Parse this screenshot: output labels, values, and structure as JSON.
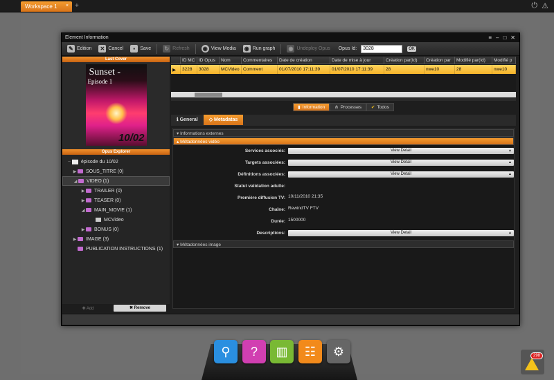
{
  "workspace_tab": {
    "label": "Workspace 1",
    "close": "×"
  },
  "add_tab": "+",
  "top_icons": {
    "power": "⏻",
    "alert": "⚠"
  },
  "window": {
    "title": "Element Information",
    "controls": [
      "≡",
      "–",
      "□",
      "✕"
    ]
  },
  "toolbar": {
    "edition": "Edition",
    "cancel": "Cancel",
    "save": "Save",
    "refresh": "Refresh",
    "view_media": "View Media",
    "run_graph": "Run graph",
    "undeploy": "Undeploy Opus",
    "opus_id_label": "Opus Id:",
    "opus_id_value": "3028",
    "ok": "OK"
  },
  "last_cover": {
    "header": "Last Cover",
    "title_line1": "Sunset -",
    "title_line2": "Episode 1",
    "number": "10/02"
  },
  "opus_explorer": {
    "header": "Opus Explorer",
    "nodes": [
      {
        "label": "épisode du 10/02",
        "toggle": "–"
      },
      {
        "label": "SOUS_TITRE (0)",
        "toggle": "▶"
      },
      {
        "label": "VIDEO (1)",
        "toggle": "◢"
      },
      {
        "label": "TRAILER (0)",
        "toggle": "▶"
      },
      {
        "label": "TEASER (0)",
        "toggle": "▶"
      },
      {
        "label": "MAIN_MOVIE (1)",
        "toggle": "◢"
      },
      {
        "label": "MCVideo",
        "toggle": ""
      },
      {
        "label": "BONUS (0)",
        "toggle": "▶"
      },
      {
        "label": "IMAGE (3)",
        "toggle": "▶"
      },
      {
        "label": "PUBLICATION INSTRUCTIONS (1)",
        "toggle": ""
      }
    ],
    "add_label": "Add",
    "remove_label": "Remove"
  },
  "grid": {
    "columns": [
      "",
      "ID MC",
      "ID Opus",
      "Nom",
      "Commentaires",
      "Date de création",
      "Date de mise à jour",
      "Création par(Id)",
      "Création par",
      "Modifié par(Id)",
      "Modifié p"
    ],
    "row": [
      "▶",
      "3228",
      "3028",
      "MCVideo",
      "Comment",
      "01/07/2010 17:11:39",
      "01/07/2010 17:11:39",
      "28",
      "nwe10",
      "28",
      "nwe10"
    ]
  },
  "view_tabs": {
    "information": "Information",
    "processes": "Processes",
    "todos": "Todos"
  },
  "detail_tabs": {
    "general": "General",
    "metadatas": "Metadatas"
  },
  "metadata": {
    "group_external": "Informations externes",
    "group_video": "Métadonnées vidéo",
    "group_image": "Métadonnées image",
    "view_detail": "View Detail",
    "fields": {
      "services": "Services associés:",
      "targets": "Targets associées:",
      "definitions": "Définitions associées:",
      "statut": "Statut validation adulte:",
      "premiere": "Première diffusion TV:",
      "premiere_value": "10/11/2010 21:35",
      "chaine": "Chaîne:",
      "chaine_value": "RewindTV FTV",
      "duree": "Durée:",
      "duree_value": "1500000",
      "descriptions": "Descriptions:"
    }
  },
  "notification_count": "298",
  "dock_colors": [
    "#2a8fe0",
    "#d13fb1",
    "#79b934",
    "#f28a1b",
    "#666666"
  ]
}
